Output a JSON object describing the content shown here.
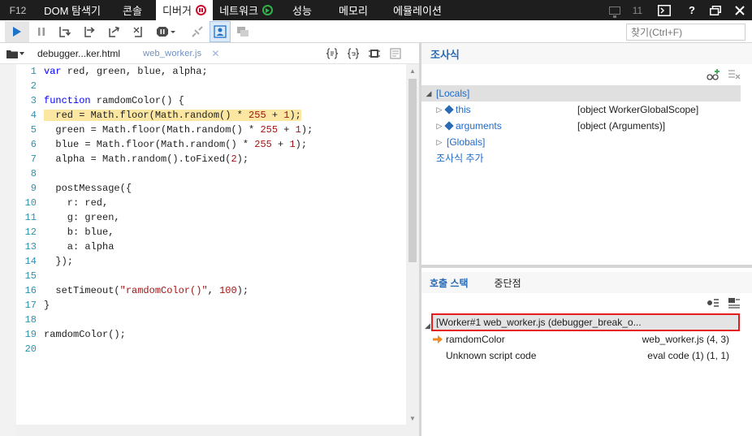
{
  "topbar": {
    "f12": "F12",
    "tabs": [
      "DOM 탐색기",
      "콘솔",
      "디버거",
      "네트워크",
      "성능",
      "메모리",
      "에뮬레이션"
    ],
    "count": "11",
    "help": "?"
  },
  "toolbar": {
    "search_placeholder": "찾기(Ctrl+F)"
  },
  "editor": {
    "file_tabs": [
      "debugger...ker.html",
      "web_worker.js"
    ],
    "lines": [
      {
        "n": "1",
        "html": "<span class=\"kw\">var</span> red, green, blue, alpha;"
      },
      {
        "n": "2",
        "html": ""
      },
      {
        "n": "3",
        "html": "<span class=\"kw\">function</span> ramdomColor() {"
      },
      {
        "n": "4",
        "html": "  red = Math.floor(Math.random() * <span class=\"num\">255</span> + <span class=\"num\">1</span>);",
        "current": true
      },
      {
        "n": "5",
        "html": "  green = Math.floor(Math.random() * <span class=\"num\">255</span> + <span class=\"num\">1</span>);"
      },
      {
        "n": "6",
        "html": "  blue = Math.floor(Math.random() * <span class=\"num\">255</span> + <span class=\"num\">1</span>);"
      },
      {
        "n": "7",
        "html": "  alpha = Math.random().toFixed(<span class=\"num\">2</span>);"
      },
      {
        "n": "8",
        "html": ""
      },
      {
        "n": "9",
        "html": "  postMessage({"
      },
      {
        "n": "10",
        "html": "    r: red,"
      },
      {
        "n": "11",
        "html": "    g: green,"
      },
      {
        "n": "12",
        "html": "    b: blue,"
      },
      {
        "n": "13",
        "html": "    a: alpha"
      },
      {
        "n": "14",
        "html": "  });"
      },
      {
        "n": "15",
        "html": ""
      },
      {
        "n": "16",
        "html": "  setTimeout(<span class=\"str\">\"ramdomColor()\"</span>, <span class=\"num\">100</span>);"
      },
      {
        "n": "17",
        "html": "}"
      },
      {
        "n": "18",
        "html": ""
      },
      {
        "n": "19",
        "html": "ramdomColor();"
      },
      {
        "n": "20",
        "html": ""
      }
    ]
  },
  "watch": {
    "title": "조사식",
    "rows": [
      {
        "name": "[Locals]",
        "value": "",
        "selected": true,
        "expanded": true,
        "indent": 0
      },
      {
        "name": "this",
        "value": "[object WorkerGlobalScope]",
        "indent": 1,
        "object": true
      },
      {
        "name": "arguments",
        "value": "[object (Arguments)]",
        "indent": 1,
        "object": true
      },
      {
        "name": "[Globals]",
        "value": "",
        "indent": 1
      },
      {
        "name": "조사식 추가",
        "value": "",
        "indent": 1,
        "add": true
      }
    ]
  },
  "callstack": {
    "tab_active": "호출 스택",
    "tab_other": "중단점",
    "worker": "[Worker#1 web_worker.js (debugger_break_o...",
    "frames": [
      {
        "name": "ramdomColor",
        "location": "web_worker.js (4, 3)",
        "current": true
      },
      {
        "name": "Unknown script code",
        "location": "eval code (1) (1, 1)"
      }
    ]
  }
}
